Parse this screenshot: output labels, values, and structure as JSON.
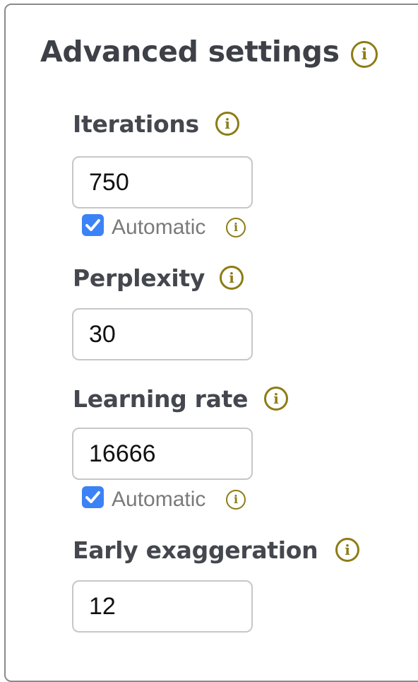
{
  "panel": {
    "title": "Advanced settings",
    "info_glyph": "i",
    "accent_color": "#8d7c15",
    "checkbox_color": "#3b82f6"
  },
  "iterations": {
    "label": "Iterations",
    "value": "750",
    "automatic": {
      "label": "Automatic",
      "checked": true
    }
  },
  "perplexity": {
    "label": "Perplexity",
    "value": "30"
  },
  "learning_rate": {
    "label": "Learning rate",
    "value": "16666",
    "automatic": {
      "label": "Automatic",
      "checked": true
    }
  },
  "early_exaggeration": {
    "label": "Early exaggeration",
    "value": "12"
  },
  "icons": {
    "info": "info-circle-icon",
    "check": "checkmark-icon"
  }
}
